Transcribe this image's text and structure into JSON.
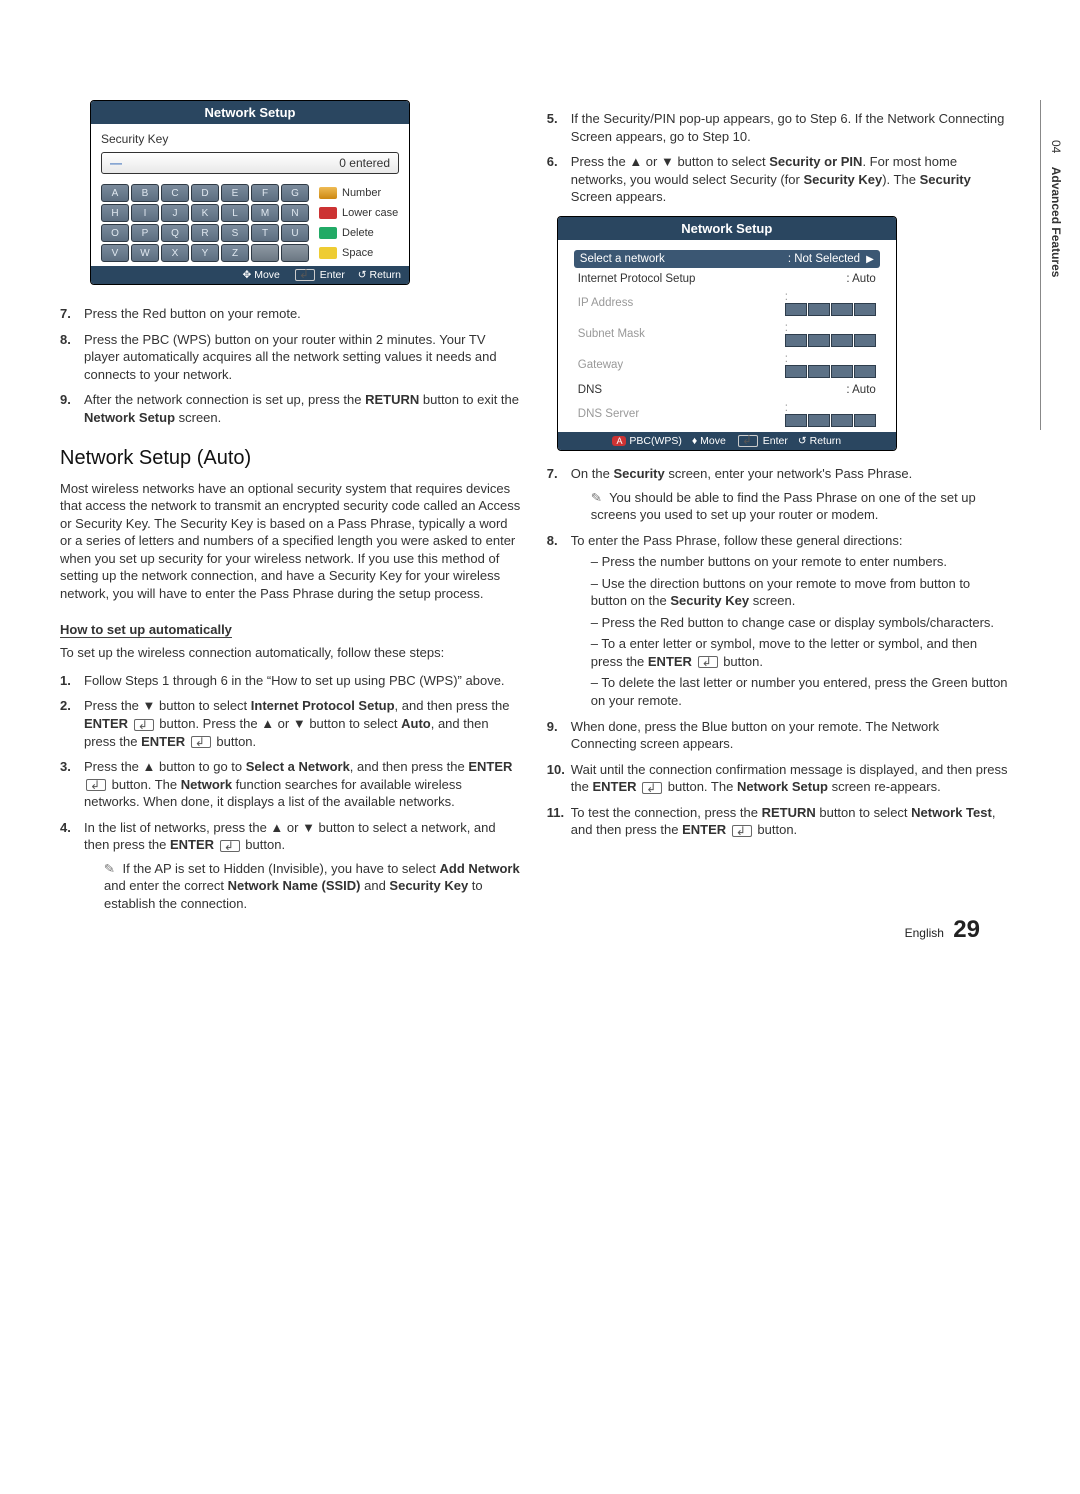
{
  "chapter": {
    "num": "04",
    "title": "Advanced Features"
  },
  "panel1": {
    "title": "Network Setup",
    "label": "Security Key",
    "entered": "0 entered",
    "keys": [
      "A",
      "B",
      "C",
      "D",
      "E",
      "F",
      "G",
      "H",
      "I",
      "J",
      "K",
      "L",
      "M",
      "N",
      "O",
      "P",
      "Q",
      "R",
      "S",
      "T",
      "U",
      "V",
      "W",
      "X",
      "Y",
      "Z",
      "",
      ""
    ],
    "side": {
      "number": "Number",
      "lower": "Lower case",
      "delete": "Delete",
      "space": "Space"
    },
    "footer": {
      "move": "Move",
      "enter": "Enter",
      "return": "Return"
    }
  },
  "left_steps_a": [
    {
      "n": "7.",
      "t": "Press the Red button on your remote."
    },
    {
      "n": "8.",
      "t": "Press the PBC (WPS) button on your router within 2 minutes. Your TV player automatically acquires all the network setting values it needs and connects to your network."
    },
    {
      "n": "9.",
      "t": "After the network connection is set up, press the RETURN button to exit the Network Setup screen.",
      "bold": [
        "RETURN",
        "Network Setup"
      ]
    }
  ],
  "section_title": "Network Setup (Auto)",
  "section_para": "Most wireless networks have an optional security system that requires devices that access the network to transmit an encrypted security code called an Access or Security Key. The Security Key is based on a Pass Phrase, typically a word or a series of letters and numbers of a specified length you were asked to enter when you set up security for your wireless network.  If you use this method of setting up the network connection, and have a Security Key for your wireless network, you will have to enter the Pass Phrase during the setup process.",
  "howto_title": "How to set up automatically",
  "howto_intro": "To set up the wireless connection automatically, follow these steps:",
  "left_steps_b": [
    {
      "n": "1.",
      "html": "Follow Steps 1 through 6 in the “How to set up using PBC (WPS)” above."
    },
    {
      "n": "2.",
      "html": "Press the ▼ button to select <b>Internet Protocol Setup</b>, and then press the <b>ENTER</b> <span class='enter-icon' data-name='enter-icon' data-interactable='false'></span> button. Press the ▲ or ▼ button to select <b>Auto</b>, and then press the <b>ENTER</b> <span class='enter-icon' data-name='enter-icon' data-interactable='false'></span> button."
    },
    {
      "n": "3.",
      "html": "Press the ▲ button to go to <b>Select a Network</b>, and then press the <b>ENTER</b> <span class='enter-icon' data-name='enter-icon' data-interactable='false'></span> button. The <b>Network</b> function searches for available wireless networks. When done, it displays a list of the available networks."
    },
    {
      "n": "4.",
      "html": "In the list of networks, press the ▲ or ▼ button to select a network, and then press the <b>ENTER</b> <span class='enter-icon' data-name='enter-icon' data-interactable='false'></span> button.",
      "note": "If the AP is set to Hidden (Invisible), you have to select <b>Add Network</b> and enter the correct <b>Network Name (SSID)</b> and <b>Security Key</b> to establish the connection."
    }
  ],
  "right_steps_a": [
    {
      "n": "5.",
      "html": "If the Security/PIN pop-up appears, go to Step 6. If the Network Connecting Screen appears, go to Step 10."
    },
    {
      "n": "6.",
      "html": "Press the ▲ or ▼ button to select <b>Security or PIN</b>. For most home networks, you would select Security (for <b>Security Key</b>). The <b>Security</b> Screen appears."
    }
  ],
  "panel2": {
    "title": "Network Setup",
    "rows": {
      "select_label": "Select a network",
      "select_value": "Not Selected",
      "ips_label": "Internet Protocol Setup",
      "ips_value": "Auto",
      "ip_label": "IP Address",
      "subnet_label": "Subnet Mask",
      "gateway_label": "Gateway",
      "dns_label": "DNS",
      "dns_value": "Auto",
      "dnss_label": "DNS Server"
    },
    "footer": {
      "pbc": "PBC(WPS)",
      "move": "Move",
      "enter": "Enter",
      "return": "Return"
    }
  },
  "right_steps_b": [
    {
      "n": "7.",
      "html": "On the <b>Security</b> screen, enter your network's Pass Phrase.",
      "note": "You should be able to find the Pass Phrase on one of the set up screens you used to set up your router or modem."
    },
    {
      "n": "8.",
      "html": "To enter the Pass Phrase, follow these general directions:",
      "dashes": [
        "Press the number buttons on your remote to enter numbers.",
        "Use the direction buttons on your remote to move from button to button on the <b>Security Key</b> screen.",
        "Press the Red button to change case or display symbols/characters.",
        "To a enter letter or symbol, move to the letter or symbol, and then press the <b>ENTER</b> <span class='enter-icon' data-name='enter-icon' data-interactable='false'></span> button.",
        "To delete the last letter or number you entered, press the Green button on your remote."
      ]
    },
    {
      "n": "9.",
      "html": "When done, press the Blue button on your remote. The Network Connecting screen appears."
    },
    {
      "n": "10.",
      "html": "Wait until the connection confirmation message is displayed, and then press the <b>ENTER</b> <span class='enter-icon' data-name='enter-icon' data-interactable='false'></span> button. The <b>Network Setup</b> screen re-appears."
    },
    {
      "n": "11.",
      "html": "To test the connection, press the <b>RETURN</b> button to select <b>Network Test</b>, and then press the <b>ENTER</b> <span class='enter-icon' data-name='enter-icon' data-interactable='false'></span> button."
    }
  ],
  "footer": {
    "lang": "English",
    "page": "29"
  }
}
